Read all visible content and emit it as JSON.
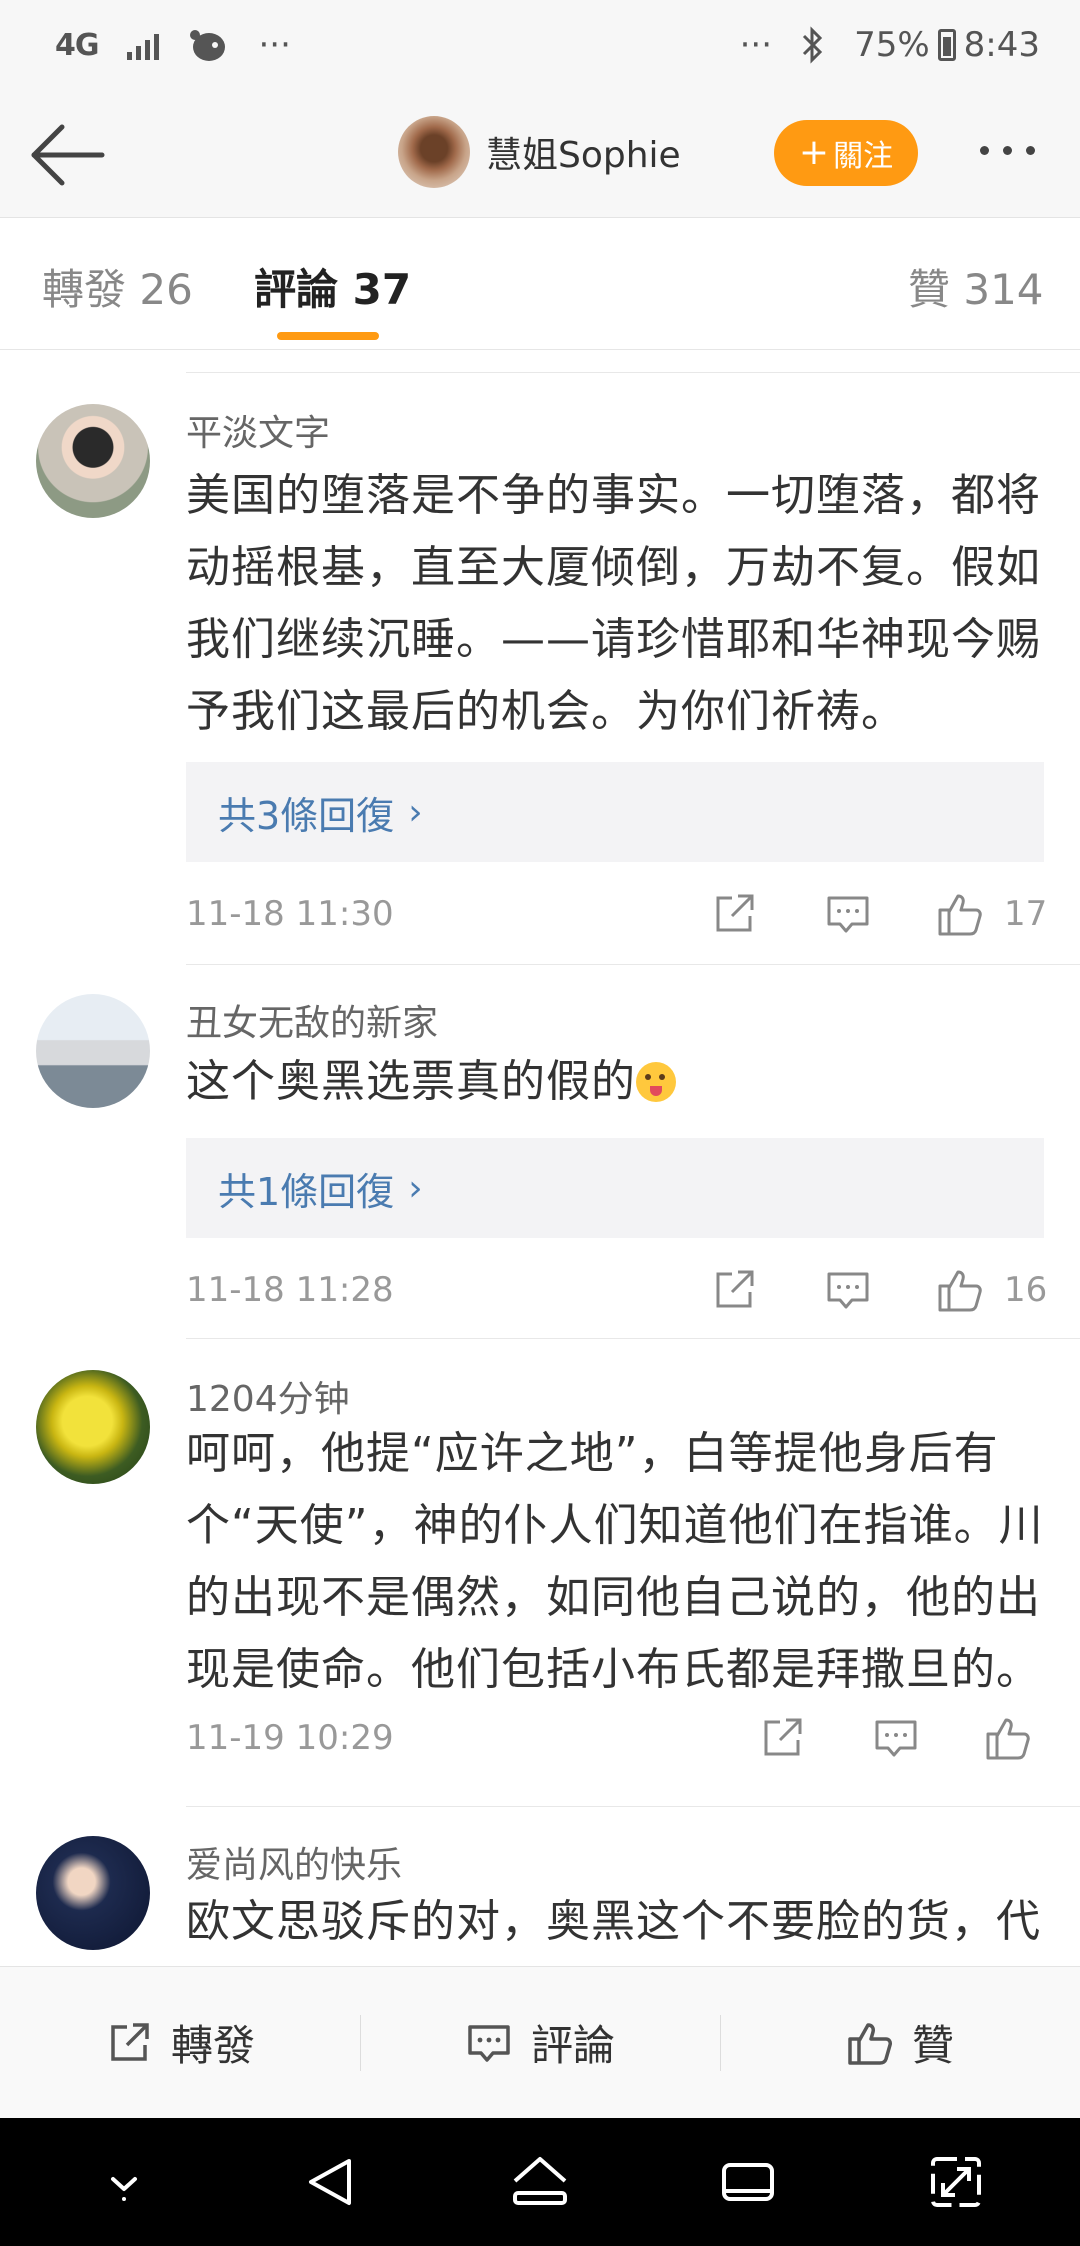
{
  "status_bar": {
    "network": "4G",
    "dots_left": "···",
    "dots_right": "···",
    "battery": "75%",
    "time": "8:43"
  },
  "header": {
    "owner_name": "慧姐Sophie",
    "follow_label": "關注"
  },
  "tabs": {
    "reposts": "轉發 26",
    "comments": "評論 37",
    "likes": "贊 314"
  },
  "comments": [
    {
      "user": "平淡文字",
      "text": "美国的堕落是不争的事实。一切堕落，都将动摇根基，直至大厦倾倒，万劫不复。假如我们继续沉睡。——请珍惜耶和华神现今赐予我们这最后的机会。为你们祈祷。",
      "replies": "共3條回復",
      "time": "11-18 11:30",
      "likes": "17"
    },
    {
      "user": "丑女无敌的新家",
      "text": "这个奥黑选票真的假的",
      "replies": "共1條回復",
      "time": "11-18 11:28",
      "likes": "16"
    },
    {
      "user": "1204分钟",
      "text": "呵呵，他提“应许之地”，白等提他身后有个“天使”，神的仆人们知道他们在指谁。川的出现不是偶然，如同他自己说的，他的出现是使命。他们包括小布氏都是拜撒旦的。",
      "time": "11-19 10:29"
    },
    {
      "user": "爱尚风的快乐",
      "text": "欧文思驳斥的对，奥黑这个不要脸的货，代"
    }
  ],
  "action_bar": {
    "repost": "轉發",
    "comment": "評論",
    "like": "贊"
  },
  "colors": {
    "accent": "#ff9a12",
    "link": "#4a7bb0"
  }
}
